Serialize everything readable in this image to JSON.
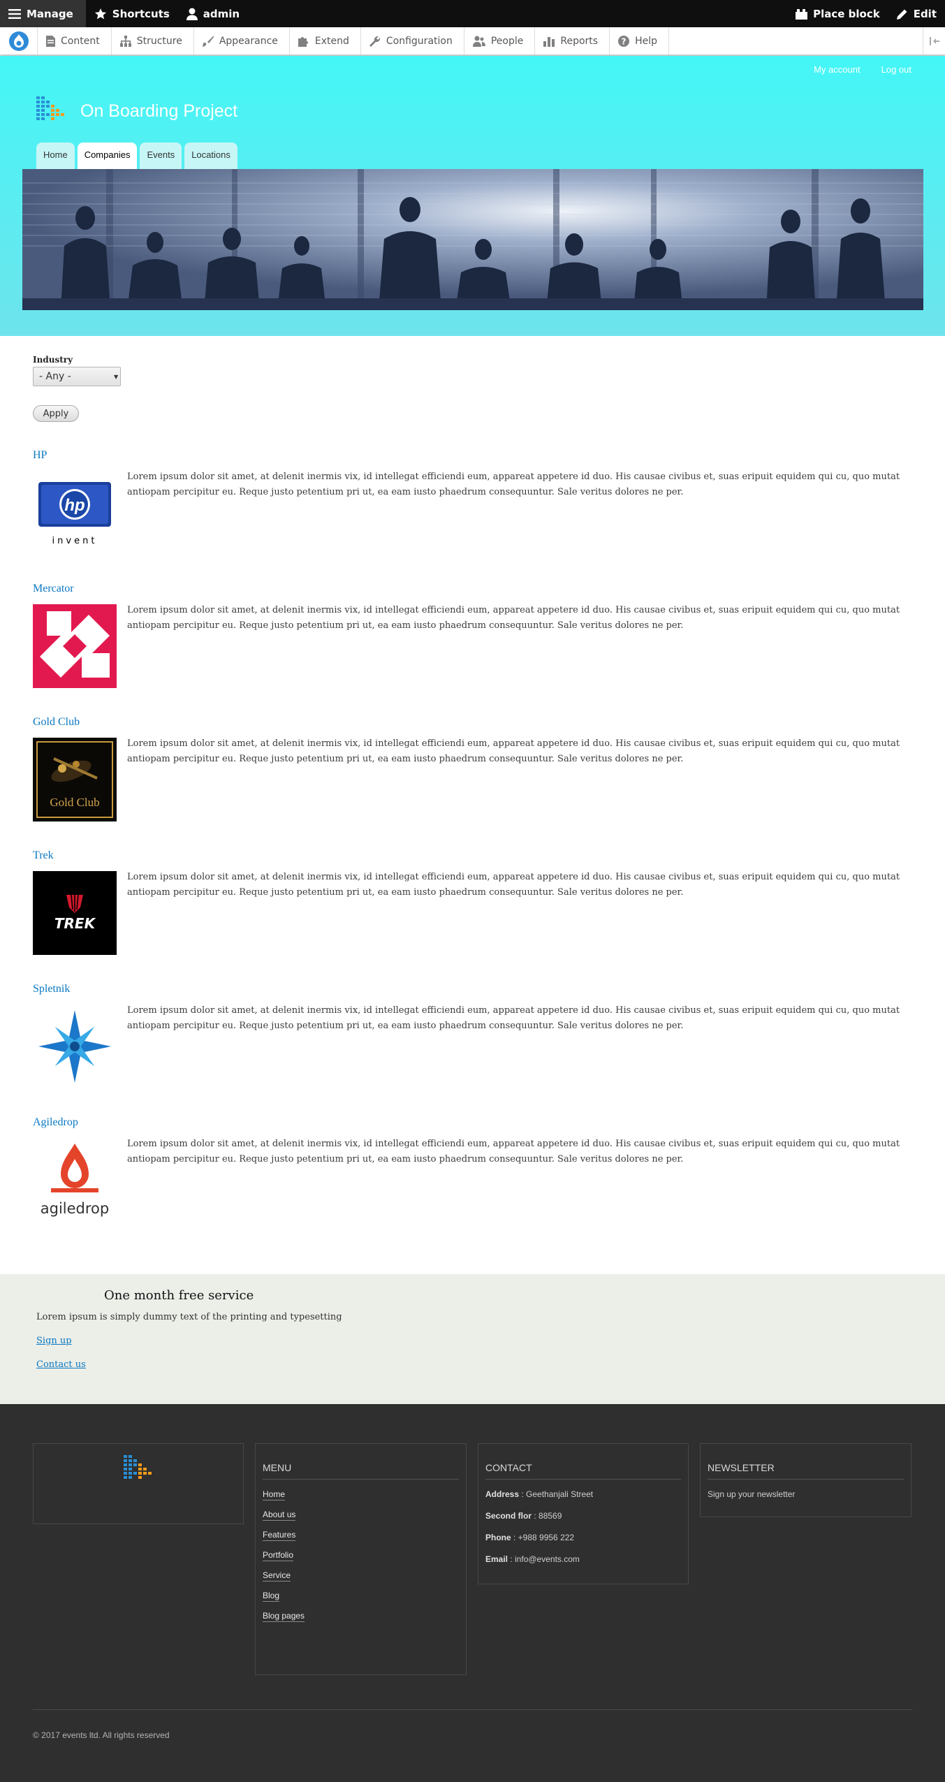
{
  "admin_toolbar": {
    "manage": "Manage",
    "shortcuts": "Shortcuts",
    "user": "admin",
    "place_block": "Place block",
    "edit": "Edit"
  },
  "admin_tray": {
    "items": [
      "Content",
      "Structure",
      "Appearance",
      "Extend",
      "Configuration",
      "People",
      "Reports",
      "Help"
    ]
  },
  "header": {
    "secondary_menu": [
      "My account",
      "Log out"
    ],
    "site_name": "On Boarding Project",
    "tabs": [
      "Home",
      "Companies",
      "Events",
      "Locations"
    ],
    "active_tab": "Companies"
  },
  "filter": {
    "label": "Industry",
    "selected": "- Any -",
    "apply": "Apply"
  },
  "companies": [
    {
      "name": "HP",
      "logo_text": "invent",
      "description": "Lorem ipsum dolor sit amet, at delenit inermis vix, id intellegat efficiendi eum, appareat appetere id duo. His causae civibus et, suas eripuit equidem qui cu, quo mutat antiopam percipitur eu. Reque justo petentium pri ut, ea eam iusto phaedrum consequuntur. Sale veritus dolores ne per."
    },
    {
      "name": "Mercator",
      "description": "Lorem ipsum dolor sit amet, at delenit inermis vix, id intellegat efficiendi eum, appareat appetere id duo. His causae civibus et, suas eripuit equidem qui cu, quo mutat antiopam percipitur eu. Reque justo petentium pri ut, ea eam iusto phaedrum consequuntur. Sale veritus dolores ne per."
    },
    {
      "name": "Gold Club",
      "logo_text": "Gold Club",
      "description": "Lorem ipsum dolor sit amet, at delenit inermis vix, id intellegat efficiendi eum, appareat appetere id duo. His causae civibus et, suas eripuit equidem qui cu, quo mutat antiopam percipitur eu. Reque justo petentium pri ut, ea eam iusto phaedrum consequuntur. Sale veritus dolores ne per."
    },
    {
      "name": "Trek",
      "logo_text": "TREK",
      "description": "Lorem ipsum dolor sit amet, at delenit inermis vix, id intellegat efficiendi eum, appareat appetere id duo. His causae civibus et, suas eripuit equidem qui cu, quo mutat antiopam percipitur eu. Reque justo petentium pri ut, ea eam iusto phaedrum consequuntur. Sale veritus dolores ne per."
    },
    {
      "name": "Spletnik",
      "description": "Lorem ipsum dolor sit amet, at delenit inermis vix, id intellegat efficiendi eum, appareat appetere id duo. His causae civibus et, suas eripuit equidem qui cu, quo mutat antiopam percipitur eu. Reque justo petentium pri ut, ea eam iusto phaedrum consequuntur. Sale veritus dolores ne per."
    },
    {
      "name": "Agiledrop",
      "logo_text": "agiledrop",
      "description": "Lorem ipsum dolor sit amet, at delenit inermis vix, id intellegat efficiendi eum, appareat appetere id duo. His causae civibus et, suas eripuit equidem qui cu, quo mutat antiopam percipitur eu. Reque justo petentium pri ut, ea eam iusto phaedrum consequuntur. Sale veritus dolores ne per."
    }
  ],
  "promo": {
    "title": "One month free service",
    "text": "Lorem ipsum is simply dummy text of the printing and typesetting",
    "links": [
      "Sign up",
      "Contact us"
    ]
  },
  "footer": {
    "menu_title": "MENU",
    "menu_items": [
      "Home",
      "About us",
      "Features",
      "Portfolio",
      "Service",
      "Blog",
      "Blog pages"
    ],
    "contact_title": "CONTACT",
    "contact": [
      {
        "label": "Address",
        "value": " : Geethanjali Street"
      },
      {
        "label": "Second flor",
        "value": " : 88569"
      },
      {
        "label": "Phone",
        "value": " : +988 9956 222"
      },
      {
        "label": "Email",
        "value": " : info@events.com"
      }
    ],
    "newsletter_title": "NEWSLETTER",
    "newsletter_text": "Sign up your newsletter",
    "copyright": "© 2017 events ltd. All rights reserved"
  },
  "colors": {
    "header_top": "#44f6f6",
    "header_bottom": "#6ee3ec",
    "link": "#0a78c2",
    "footer_bg": "#2f2f2f",
    "promo_bg": "#eceee8"
  }
}
